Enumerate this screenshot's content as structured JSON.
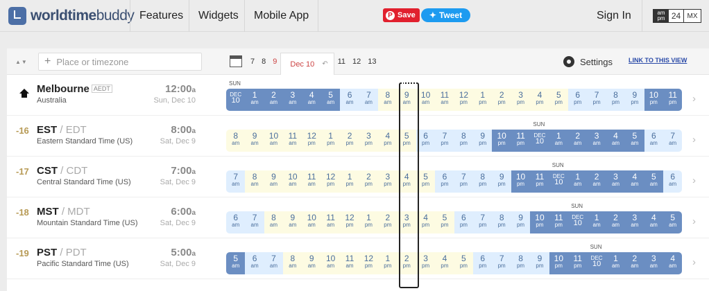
{
  "brand": {
    "name_bold": "worldtime",
    "name_rest": "buddy"
  },
  "nav": [
    "Features",
    "Widgets",
    "Mobile App"
  ],
  "social": {
    "save": "Save",
    "tweet": "Tweet"
  },
  "signin": "Sign In",
  "format": {
    "am": "am",
    "pm": "pm",
    "h24": "24",
    "mx": "MX"
  },
  "search": {
    "placeholder": "Place or timezone"
  },
  "dates": {
    "items": [
      "7",
      "8",
      "9"
    ],
    "selected": "Dec 10",
    "after": [
      "11",
      "12",
      "13"
    ]
  },
  "settings": "Settings",
  "link": "LINK TO THIS VIEW",
  "rows": [
    {
      "offset": "",
      "city": "Melbourne",
      "abbr": "AEDT",
      "alt": "",
      "sub": "Australia",
      "time": "12:00",
      "suffix": "a",
      "date": "Sun, Dec 10",
      "daylabel": "SUN",
      "daylabel_index": 0,
      "cells": [
        [
          "DEC",
          "10",
          "d"
        ],
        [
          "1",
          "am",
          "n"
        ],
        [
          "2",
          "am",
          "n"
        ],
        [
          "3",
          "am",
          "n"
        ],
        [
          "4",
          "am",
          "n"
        ],
        [
          "5",
          "am",
          "n"
        ],
        [
          "6",
          "am",
          "w"
        ],
        [
          "7",
          "am",
          "w"
        ],
        [
          "8",
          "am",
          "y"
        ],
        [
          "9",
          "am",
          "y"
        ],
        [
          "10",
          "am",
          "y"
        ],
        [
          "11",
          "am",
          "y"
        ],
        [
          "12",
          "pm",
          "y"
        ],
        [
          "1",
          "pm",
          "y"
        ],
        [
          "2",
          "pm",
          "y"
        ],
        [
          "3",
          "pm",
          "y"
        ],
        [
          "4",
          "pm",
          "y"
        ],
        [
          "5",
          "pm",
          "y"
        ],
        [
          "6",
          "pm",
          "w"
        ],
        [
          "7",
          "pm",
          "w"
        ],
        [
          "8",
          "pm",
          "w"
        ],
        [
          "9",
          "pm",
          "w"
        ],
        [
          "10",
          "pm",
          "n"
        ],
        [
          "11",
          "pm",
          "n"
        ]
      ]
    },
    {
      "offset": "-16",
      "city": "EST",
      "abbr": "",
      "alt": "/ EDT",
      "sub": "Eastern Standard Time (US)",
      "time": "8:00",
      "suffix": "a",
      "date": "Sat, Dec 9",
      "daylabel": "SUN",
      "daylabel_index": 16,
      "cells": [
        [
          "8",
          "am",
          "y"
        ],
        [
          "9",
          "am",
          "y"
        ],
        [
          "10",
          "am",
          "y"
        ],
        [
          "11",
          "am",
          "y"
        ],
        [
          "12",
          "pm",
          "y"
        ],
        [
          "1",
          "pm",
          "y"
        ],
        [
          "2",
          "pm",
          "y"
        ],
        [
          "3",
          "pm",
          "y"
        ],
        [
          "4",
          "pm",
          "y"
        ],
        [
          "5",
          "pm",
          "y"
        ],
        [
          "6",
          "pm",
          "w"
        ],
        [
          "7",
          "pm",
          "w"
        ],
        [
          "8",
          "pm",
          "w"
        ],
        [
          "9",
          "pm",
          "w"
        ],
        [
          "10",
          "pm",
          "n"
        ],
        [
          "11",
          "pm",
          "n"
        ],
        [
          "DEC",
          "10",
          "d"
        ],
        [
          "1",
          "am",
          "n"
        ],
        [
          "2",
          "am",
          "n"
        ],
        [
          "3",
          "am",
          "n"
        ],
        [
          "4",
          "am",
          "n"
        ],
        [
          "5",
          "am",
          "n"
        ],
        [
          "6",
          "am",
          "w"
        ],
        [
          "7",
          "am",
          "w"
        ]
      ]
    },
    {
      "offset": "-17",
      "city": "CST",
      "abbr": "",
      "alt": "/ CDT",
      "sub": "Central Standard Time (US)",
      "time": "7:00",
      "suffix": "a",
      "date": "Sat, Dec 9",
      "daylabel": "SUN",
      "daylabel_index": 17,
      "cells": [
        [
          "7",
          "am",
          "w"
        ],
        [
          "8",
          "am",
          "y"
        ],
        [
          "9",
          "am",
          "y"
        ],
        [
          "10",
          "am",
          "y"
        ],
        [
          "11",
          "am",
          "y"
        ],
        [
          "12",
          "pm",
          "y"
        ],
        [
          "1",
          "pm",
          "y"
        ],
        [
          "2",
          "pm",
          "y"
        ],
        [
          "3",
          "pm",
          "y"
        ],
        [
          "4",
          "pm",
          "y"
        ],
        [
          "5",
          "pm",
          "y"
        ],
        [
          "6",
          "pm",
          "w"
        ],
        [
          "7",
          "pm",
          "w"
        ],
        [
          "8",
          "pm",
          "w"
        ],
        [
          "9",
          "pm",
          "w"
        ],
        [
          "10",
          "pm",
          "n"
        ],
        [
          "11",
          "pm",
          "n"
        ],
        [
          "DEC",
          "10",
          "d"
        ],
        [
          "1",
          "am",
          "n"
        ],
        [
          "2",
          "am",
          "n"
        ],
        [
          "3",
          "am",
          "n"
        ],
        [
          "4",
          "am",
          "n"
        ],
        [
          "5",
          "am",
          "n"
        ],
        [
          "6",
          "am",
          "w"
        ]
      ]
    },
    {
      "offset": "-18",
      "city": "MST",
      "abbr": "",
      "alt": "/ MDT",
      "sub": "Mountain Standard Time (US)",
      "time": "6:00",
      "suffix": "a",
      "date": "Sat, Dec 9",
      "daylabel": "SUN",
      "daylabel_index": 18,
      "cells": [
        [
          "6",
          "am",
          "w"
        ],
        [
          "7",
          "am",
          "w"
        ],
        [
          "8",
          "am",
          "y"
        ],
        [
          "9",
          "am",
          "y"
        ],
        [
          "10",
          "am",
          "y"
        ],
        [
          "11",
          "am",
          "y"
        ],
        [
          "12",
          "pm",
          "y"
        ],
        [
          "1",
          "pm",
          "y"
        ],
        [
          "2",
          "pm",
          "y"
        ],
        [
          "3",
          "pm",
          "y"
        ],
        [
          "4",
          "pm",
          "y"
        ],
        [
          "5",
          "pm",
          "y"
        ],
        [
          "6",
          "pm",
          "w"
        ],
        [
          "7",
          "pm",
          "w"
        ],
        [
          "8",
          "pm",
          "w"
        ],
        [
          "9",
          "pm",
          "w"
        ],
        [
          "10",
          "pm",
          "n"
        ],
        [
          "11",
          "pm",
          "n"
        ],
        [
          "DEC",
          "10",
          "d"
        ],
        [
          "1",
          "am",
          "n"
        ],
        [
          "2",
          "am",
          "n"
        ],
        [
          "3",
          "am",
          "n"
        ],
        [
          "4",
          "am",
          "n"
        ],
        [
          "5",
          "am",
          "n"
        ]
      ]
    },
    {
      "offset": "-19",
      "city": "PST",
      "abbr": "",
      "alt": "/ PDT",
      "sub": "Pacific Standard Time (US)",
      "time": "5:00",
      "suffix": "a",
      "date": "Sat, Dec 9",
      "daylabel": "SUN",
      "daylabel_index": 19,
      "cells": [
        [
          "5",
          "am",
          "n"
        ],
        [
          "6",
          "am",
          "w"
        ],
        [
          "7",
          "am",
          "w"
        ],
        [
          "8",
          "am",
          "y"
        ],
        [
          "9",
          "am",
          "y"
        ],
        [
          "10",
          "am",
          "y"
        ],
        [
          "11",
          "am",
          "y"
        ],
        [
          "12",
          "pm",
          "y"
        ],
        [
          "1",
          "pm",
          "y"
        ],
        [
          "2",
          "pm",
          "y"
        ],
        [
          "3",
          "pm",
          "y"
        ],
        [
          "4",
          "pm",
          "y"
        ],
        [
          "5",
          "pm",
          "y"
        ],
        [
          "6",
          "pm",
          "w"
        ],
        [
          "7",
          "pm",
          "w"
        ],
        [
          "8",
          "pm",
          "w"
        ],
        [
          "9",
          "pm",
          "w"
        ],
        [
          "10",
          "pm",
          "n"
        ],
        [
          "11",
          "pm",
          "n"
        ],
        [
          "DEC",
          "10",
          "d"
        ],
        [
          "1",
          "am",
          "n"
        ],
        [
          "2",
          "am",
          "n"
        ],
        [
          "3",
          "am",
          "n"
        ],
        [
          "4",
          "am",
          "n"
        ]
      ]
    }
  ]
}
